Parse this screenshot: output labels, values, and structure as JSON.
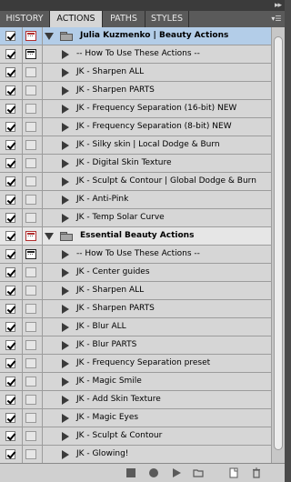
{
  "tabs": [
    {
      "label": "HISTORY",
      "active": false
    },
    {
      "label": "ACTIONS",
      "active": true
    },
    {
      "label": "PATHS",
      "active": false
    },
    {
      "label": "STYLES",
      "active": false
    }
  ],
  "icons": {
    "collapse": "double-chevron-right-icon",
    "panel_menu": "panel-menu-icon",
    "stop": "stop-recording-icon",
    "record": "record-icon",
    "play": "play-selection-icon",
    "new_set": "new-set-folder-icon",
    "new_action": "new-action-icon",
    "delete": "trash-icon"
  },
  "colors": {
    "selected_row": "#b3cde8",
    "dialog_red": "#b03030"
  },
  "rows": [
    {
      "type": "set",
      "label": "Julia Kuzmenko | Beauty Actions",
      "expanded": true,
      "selected": true,
      "dialog": "red"
    },
    {
      "type": "action",
      "label": "-- How To Use These Actions --",
      "dialog": "dark"
    },
    {
      "type": "action",
      "label": "JK - Sharpen ALL",
      "dialog": "none"
    },
    {
      "type": "action",
      "label": "JK - Sharpen PARTS",
      "dialog": "none"
    },
    {
      "type": "action",
      "label": "JK - Frequency Separation (16-bit) NEW",
      "dialog": "none"
    },
    {
      "type": "action",
      "label": "JK - Frequency Separation (8-bit) NEW",
      "dialog": "none"
    },
    {
      "type": "action",
      "label": "JK - Silky skin | Local Dodge & Burn",
      "dialog": "none"
    },
    {
      "type": "action",
      "label": "JK - Digital Skin Texture",
      "dialog": "none"
    },
    {
      "type": "action",
      "label": "JK - Sculpt & Contour | Global Dodge & Burn",
      "dialog": "none"
    },
    {
      "type": "action",
      "label": "JK - Anti-Pink",
      "dialog": "none"
    },
    {
      "type": "action",
      "label": "JK - Temp Solar Curve",
      "dialog": "none"
    },
    {
      "type": "set",
      "label": "Essential Beauty Actions",
      "expanded": true,
      "selected": false,
      "dialog": "red"
    },
    {
      "type": "action",
      "label": "-- How To Use These Actions --",
      "dialog": "dark"
    },
    {
      "type": "action",
      "label": "JK - Center guides",
      "dialog": "none"
    },
    {
      "type": "action",
      "label": "JK - Sharpen ALL",
      "dialog": "none"
    },
    {
      "type": "action",
      "label": "JK - Sharpen PARTS",
      "dialog": "none"
    },
    {
      "type": "action",
      "label": "JK - Blur ALL",
      "dialog": "none"
    },
    {
      "type": "action",
      "label": "JK - Blur PARTS",
      "dialog": "none"
    },
    {
      "type": "action",
      "label": "JK - Frequency Separation preset",
      "dialog": "none"
    },
    {
      "type": "action",
      "label": "JK - Magic Smile",
      "dialog": "none"
    },
    {
      "type": "action",
      "label": "JK - Add Skin Texture",
      "dialog": "none"
    },
    {
      "type": "action",
      "label": "JK - Magic Eyes",
      "dialog": "none"
    },
    {
      "type": "action",
      "label": "JK - Sculpt & Contour",
      "dialog": "none"
    },
    {
      "type": "action",
      "label": "JK - Glowing!",
      "dialog": "none"
    }
  ]
}
